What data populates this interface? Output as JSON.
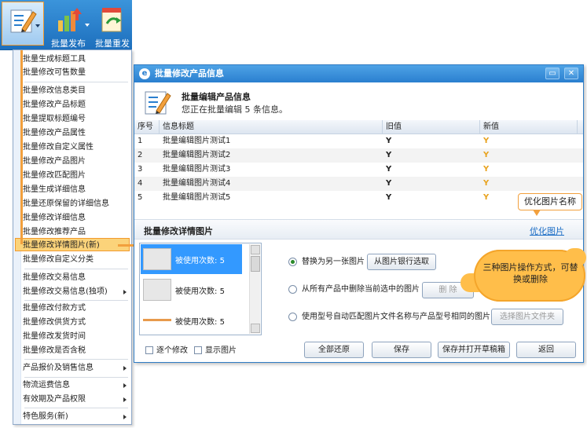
{
  "toolbar": {
    "btn_edit_label": "",
    "btn_publish_label": "批量发布",
    "btn_republish_label": "批量重发"
  },
  "menu": {
    "items": [
      {
        "label": "批量生成标题工具",
        "sub": false
      },
      {
        "label": "批量修改可售数量",
        "sub": false
      },
      {
        "label": "批量修改信息类目",
        "sub": false
      },
      {
        "label": "批量修改产品标题",
        "sub": false
      },
      {
        "label": "批量提取标题编号",
        "sub": false
      },
      {
        "label": "批量修改产品属性",
        "sub": false
      },
      {
        "label": "批量修改自定义属性",
        "sub": false
      },
      {
        "label": "批量修改产品图片",
        "sub": false
      },
      {
        "label": "批量修改匹配图片",
        "sub": false
      },
      {
        "label": "批量生成详细信息",
        "sub": false
      },
      {
        "label": "批量还原保留的详细信息",
        "sub": false
      },
      {
        "label": "批量修改详细信息",
        "sub": false
      },
      {
        "label": "批量修改推荐产品",
        "sub": false
      },
      {
        "label": "批量修改详情图片(新)",
        "sub": false
      },
      {
        "label": "批量修改自定义分类",
        "sub": false
      },
      {
        "label": "批量修改交易信息",
        "sub": false
      },
      {
        "label": "批量修改交易信息(独项)",
        "sub": true
      },
      {
        "label": "批量修改付款方式",
        "sub": false
      },
      {
        "label": "批量修改供货方式",
        "sub": false
      },
      {
        "label": "批量修改发货时间",
        "sub": false
      },
      {
        "label": "批量修改是否含税",
        "sub": false
      },
      {
        "label": "产品报价及销售信息",
        "sub": true
      },
      {
        "label": "物流运费信息",
        "sub": true
      },
      {
        "label": "有效期及产品权限",
        "sub": true
      },
      {
        "label": "特色服务(新)",
        "sub": true
      }
    ]
  },
  "dialog": {
    "title": "批量修改产品信息",
    "header_title": "批量编辑产品信息",
    "header_subtitle": "您正在批量编辑 5 条信息。",
    "columns": {
      "no": "序号",
      "title": "信息标题",
      "old": "旧值",
      "new": "新值"
    },
    "rows": [
      {
        "no": "1",
        "title": "批量编辑图片测试1",
        "old": "Y",
        "new": "Y"
      },
      {
        "no": "2",
        "title": "批量编辑图片测试2",
        "old": "Y",
        "new": "Y"
      },
      {
        "no": "3",
        "title": "批量编辑图片测试3",
        "old": "Y",
        "new": "Y"
      },
      {
        "no": "4",
        "title": "批量编辑图片测试4",
        "old": "Y",
        "new": "Y"
      },
      {
        "no": "5",
        "title": "批量编辑图片测试5",
        "old": "Y",
        "new": "Y"
      }
    ],
    "section_title": "批量修改详情图片",
    "optimize_link": "优化图片",
    "thumbs": [
      {
        "label": "被使用次数:",
        "count": "5"
      },
      {
        "label": "被使用次数:",
        "count": "5"
      },
      {
        "label": "被使用次数:",
        "count": "5"
      }
    ],
    "options": {
      "replace_label": "替换为另一张图片",
      "replace_button": "从图片银行选取",
      "delete_label": "从所有产品中删除当前选中的图片",
      "delete_button": "删 除",
      "match_label": "使用型号自动匹配图片文件名称与产品型号相同的图片",
      "match_button": "选择图片文件夹"
    },
    "footer": {
      "check_each": "逐个修改",
      "check_show": "显示图片",
      "restore": "全部还原",
      "save": "保存",
      "save_open": "保存并打开草稿箱",
      "back": "返回"
    }
  },
  "callouts": {
    "optimize": "优化图片名称",
    "ops": "三种图片操作方式，可替换或删除"
  }
}
